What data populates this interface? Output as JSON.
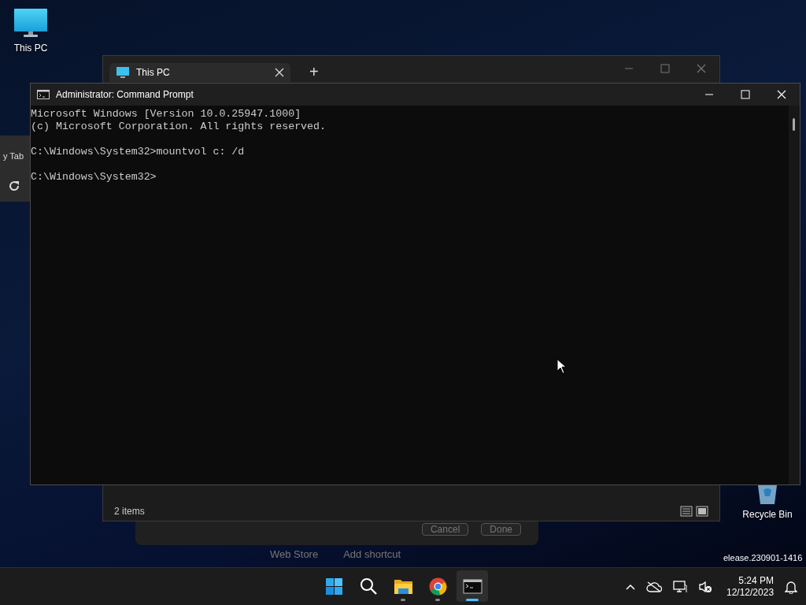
{
  "desktop_icons": [
    {
      "label": "This PC",
      "kind": "computer"
    },
    {
      "label": "Recycle Bin",
      "kind": "bin"
    }
  ],
  "side_panel": {
    "label": "y Tab"
  },
  "background_dialog": {
    "buttons": [
      "Cancel",
      "Done"
    ],
    "links": [
      "Web Store",
      "Add shortcut"
    ]
  },
  "explorer": {
    "tabs": [
      {
        "label": "This PC"
      }
    ],
    "new_tab": "+",
    "status": "2 items"
  },
  "cmd": {
    "title": "Administrator: Command Prompt",
    "paragraphs": [
      [
        "Microsoft Windows [Version 10.0.25947.1000]",
        "(c) Microsoft Corporation. All rights reserved."
      ],
      [
        "C:\\Windows\\System32>mountvol c: /d"
      ],
      [
        "C:\\Windows\\System32>"
      ]
    ]
  },
  "build": "elease.230901-1416",
  "taskbar": {
    "apps": [
      {
        "kind": "start",
        "running": false,
        "selected": false
      },
      {
        "kind": "search",
        "running": false,
        "selected": false
      },
      {
        "kind": "folder",
        "running": true,
        "selected": false
      },
      {
        "kind": "browser",
        "running": true,
        "selected": false
      },
      {
        "kind": "terminal",
        "running": true,
        "selected": true
      }
    ],
    "tray": [
      {
        "kind": "chevron"
      },
      {
        "kind": "cloud-off"
      },
      {
        "kind": "network"
      },
      {
        "kind": "sound-muted"
      }
    ],
    "time": "5:24 PM",
    "date": "12/12/2023"
  }
}
